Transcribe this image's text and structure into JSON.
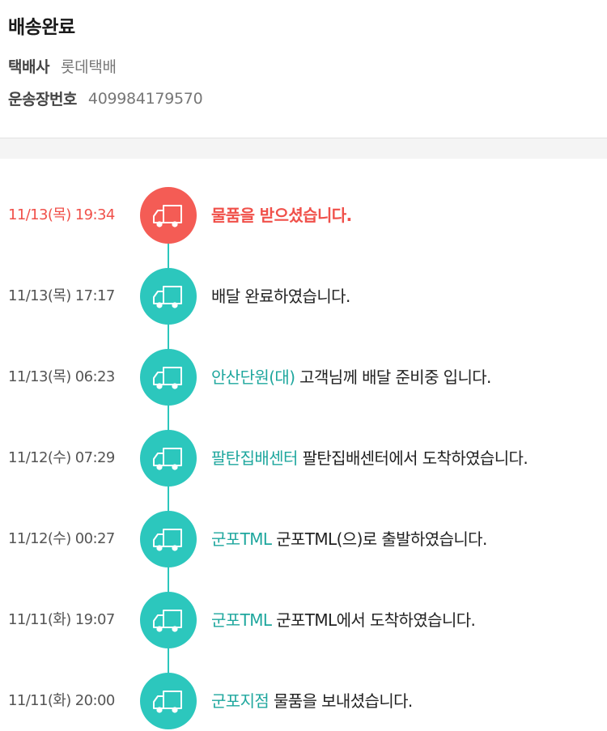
{
  "header": {
    "status": "배송완료",
    "carrier_label": "택배사",
    "carrier_value": "롯데택배",
    "tracking_label": "운송장번호",
    "tracking_value": "409984179570"
  },
  "colors": {
    "accent_teal": "#2cc7bd",
    "location_text": "#1fa79e",
    "latest_red": "#f45c55"
  },
  "timeline": {
    "icon": "delivery-truck-icon",
    "events": [
      {
        "time": "11/13(목) 19:34",
        "location": "",
        "message": "물품을 받으셨습니다."
      },
      {
        "time": "11/13(목) 17:17",
        "location": "",
        "message": "배달 완료하였습니다."
      },
      {
        "time": "11/13(목) 06:23",
        "location": "안산단원(대)",
        "message": "고객님께 배달 준비중 입니다."
      },
      {
        "time": "11/12(수) 07:29",
        "location": "팔탄집배센터",
        "message": "팔탄집배센터에서 도착하였습니다."
      },
      {
        "time": "11/12(수) 00:27",
        "location": "군포TML",
        "message": "군포TML(으)로 출발하였습니다."
      },
      {
        "time": "11/11(화) 19:07",
        "location": "군포TML",
        "message": "군포TML에서 도착하였습니다."
      },
      {
        "time": "11/11(화) 20:00",
        "location": "군포지점",
        "message": "물품을 보내셨습니다."
      }
    ]
  }
}
